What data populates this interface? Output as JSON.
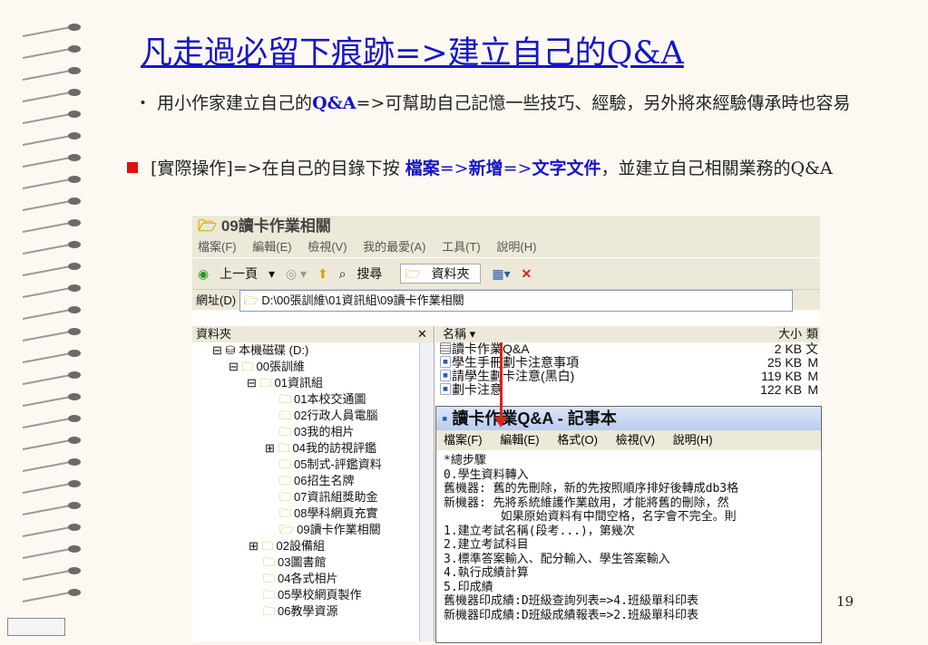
{
  "slide": {
    "title": "凡走過必留下痕跡=>建立自己的Q&A",
    "bullet1_pre": "用小作家建立自己的",
    "bullet1_qa": "Q&A",
    "bullet1_post": "=>可幫助自己記憶一些技巧、經驗，另外將來經驗傳承時也容易",
    "bullet2_pre": "[實際操作]=>在自己的目錄下按 ",
    "bullet2_file": "檔案",
    "bullet2_sep1": "=>",
    "bullet2_new": "新增",
    "bullet2_sep2": "=>",
    "bullet2_doc": "文字文件",
    "bullet2_post": "，並建立自己相關業務的Q&A",
    "page_number": "19"
  },
  "explorer": {
    "title": "09讀卡作業相關",
    "menu": [
      "檔案(F)",
      "編輯(E)",
      "檢視(V)",
      "我的最愛(A)",
      "工具(T)",
      "說明(H)"
    ],
    "toolbar": {
      "back": "上一頁",
      "search": "搜尋",
      "folders": "資料夾"
    },
    "address_label": "網址(D)",
    "address": "D:\\00張訓維\\01資訊組\\09讀卡作業相關",
    "left_header": "資料夾",
    "tree": [
      "本機磁碟 (D:)",
      "00張訓維",
      "01資訊組",
      "01本校交通圖",
      "02行政人員電腦",
      "03我的相片",
      "04我的訪視評鑑",
      "05制式-評鑑資料",
      "06招生名牌",
      "07資訊組獎助金",
      "08學科網頁充實",
      "09讀卡作業相關",
      "02設備組",
      "03圖書館",
      "04各式相片",
      "05學校網頁製作",
      "06教學資源"
    ],
    "columns": {
      "name": "名稱",
      "size": "大小",
      "type": "類"
    },
    "files": [
      {
        "name": "讀卡作業Q&A",
        "size": "2 KB",
        "type": "文"
      },
      {
        "name": "學生手冊劃卡注意事項",
        "size": "25 KB",
        "type": "M"
      },
      {
        "name": "請學生劃卡注意(黑白)",
        "size": "119 KB",
        "type": "M"
      },
      {
        "name": "劃卡注意",
        "size": "122 KB",
        "type": "M"
      }
    ]
  },
  "notepad": {
    "title": "讀卡作業Q&A - 記事本",
    "menu": [
      "檔案(F)",
      "編輯(E)",
      "格式(O)",
      "檢視(V)",
      "說明(H)"
    ],
    "lines": [
      "*總步驟",
      "0.學生資料轉入",
      "舊機器: 舊的先刪除，新的先按照順序排好後轉成db3格",
      "新機器: 先將系統維護作業啟用，才能將舊的刪除，然",
      "        如果原始資料有中間空格，名字會不完全。則",
      "1.建立考試名稱(段考...)，第幾次",
      "2.建立考試科目",
      "3.標準答案輸入、配分輸入、學生答案輸入",
      "4.執行成績計算",
      "5.印成績",
      "舊機器印成績:D班級查詢列表=>4.班級單科印表",
      "新機器印成績:D班級成績報表=>2.班級單科印表"
    ]
  }
}
